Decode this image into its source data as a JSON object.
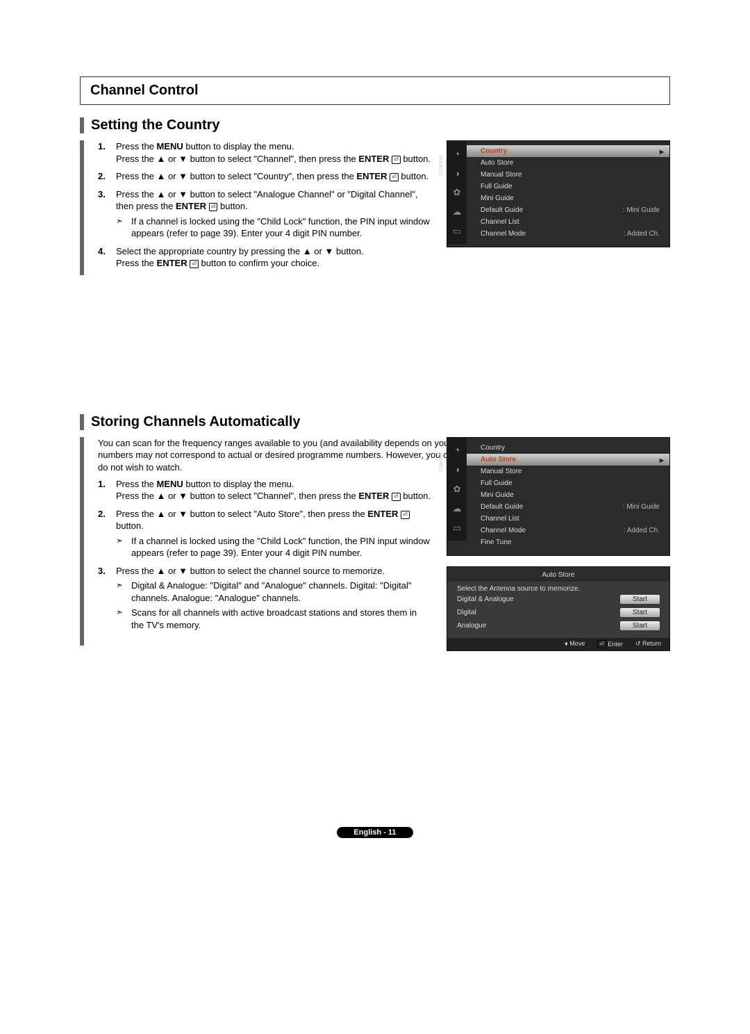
{
  "header": {
    "title": "Channel Control"
  },
  "section1": {
    "heading": "Setting the Country",
    "steps": {
      "s1a": "Press the ",
      "s1b": "MENU",
      "s1c": " button to display the menu.",
      "s1d": "Press the ▲ or ▼ button to select \"Channel\", then press the ",
      "s1e": "ENTER",
      "s1f": " button.",
      "s2a": "Press the ▲ or ▼ button to select \"Country\", then press the ",
      "s2b": "ENTER",
      "s2c": " button.",
      "s3a": "Press the ▲ or ▼ button to select \"Analogue Channel\" or \"Digital Channel\", then press the ",
      "s3b": "ENTER",
      "s3c": " button.",
      "s3sub": "If a channel is locked using the \"Child Lock\" function, the PIN input window appears (refer to page 39). Enter your 4 digit PIN number.",
      "s4a": "Select the appropriate country by pressing the ▲ or ▼ button.",
      "s4b": "Press the ",
      "s4c": "ENTER",
      "s4d": " button to confirm your choice."
    }
  },
  "osd1": {
    "tab_label": "Channel",
    "items": [
      {
        "label": "Country",
        "selected": true
      },
      {
        "label": "Auto Store"
      },
      {
        "label": "Manual Store"
      },
      {
        "label": "Full Guide"
      },
      {
        "label": "Mini Guide"
      },
      {
        "label": "Default Guide",
        "value": ": Mini Guide"
      },
      {
        "label": "Channel List"
      },
      {
        "label": "Channel Mode",
        "value": ": Added Ch."
      }
    ]
  },
  "section2": {
    "heading": "Storing Channels Automatically",
    "intro": "You can scan for the frequency ranges available to you (and availability depends on your country). Automatically allocated programme numbers may not correspond to actual or desired programme numbers. However, you can sort numbers manually and clear any channels you do not wish to watch.",
    "steps": {
      "s1a": "Press the ",
      "s1b": "MENU",
      "s1c": " button to display the menu.",
      "s1d": "Press the ▲ or ▼ button to select \"Channel\", then press the ",
      "s1e": "ENTER",
      "s1f": " button.",
      "s2a": "Press the ▲ or ▼ button to select \"Auto Store\", then press the ",
      "s2b": "ENTER",
      "s2c": " button.",
      "s2sub": "If a channel is locked using the \"Child Lock\" function, the PIN input window appears (refer to page 39). Enter your 4 digit PIN number.",
      "s3a": "Press the ▲ or ▼ button to select the channel source to memorize.",
      "s3sub1": "Digital & Analogue: \"Digital\" and \"Analogue\" channels. Digital: \"Digital\" channels. Analogue: \"Analogue\" channels.",
      "s3sub2": "Scans for all channels with active broadcast stations and stores them in the TV's memory."
    }
  },
  "osd2": {
    "tab_label": "Channel",
    "items": [
      {
        "label": "Country"
      },
      {
        "label": "Auto Store",
        "selected": true
      },
      {
        "label": "Manual Store"
      },
      {
        "label": "Full Guide"
      },
      {
        "label": "Mini Guide"
      },
      {
        "label": "Default Guide",
        "value": ": Mini Guide"
      },
      {
        "label": "Channel List"
      },
      {
        "label": "Channel Mode",
        "value": ": Added Ch."
      },
      {
        "label": "Fine Tune"
      }
    ]
  },
  "osd3": {
    "title": "Auto Store",
    "desc": "Select the Antenna source to memorize.",
    "rows": [
      {
        "label": "Digital & Analogue",
        "btn": "Start"
      },
      {
        "label": "Digital",
        "btn": "Start"
      },
      {
        "label": "Analogue",
        "btn": "Start"
      }
    ],
    "footer": {
      "move": "Move",
      "enter": "Enter",
      "return": "Return"
    }
  },
  "footer": {
    "text": "English - 11"
  }
}
